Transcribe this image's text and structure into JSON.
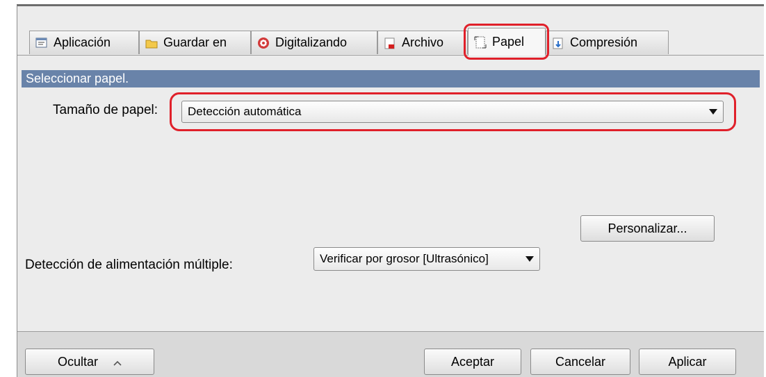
{
  "tabs": [
    {
      "label": "Aplicación",
      "icon": "application-icon"
    },
    {
      "label": "Guardar en",
      "icon": "folder-icon"
    },
    {
      "label": "Digitalizando",
      "icon": "scan-icon"
    },
    {
      "label": "Archivo",
      "icon": "file-icon"
    },
    {
      "label": "Papel",
      "icon": "paper-icon"
    },
    {
      "label": "Compresión",
      "icon": "compression-icon"
    }
  ],
  "active_tab": "Papel",
  "section_header": "Seleccionar papel.",
  "paper_size": {
    "label": "Tamaño de papel:",
    "value": "Detección automática"
  },
  "customize_button": "Personalizar...",
  "multifeed": {
    "label": "Detección de alimentación múltiple:",
    "value": "Verificar por grosor [Ultrasónico]"
  },
  "footer": {
    "hide_button": "Ocultar",
    "ok_button": "Aceptar",
    "cancel_button": "Cancelar",
    "apply_button": "Aplicar"
  },
  "colors": {
    "section_header_bg": "#6983a9",
    "highlight": "#e0202a"
  }
}
